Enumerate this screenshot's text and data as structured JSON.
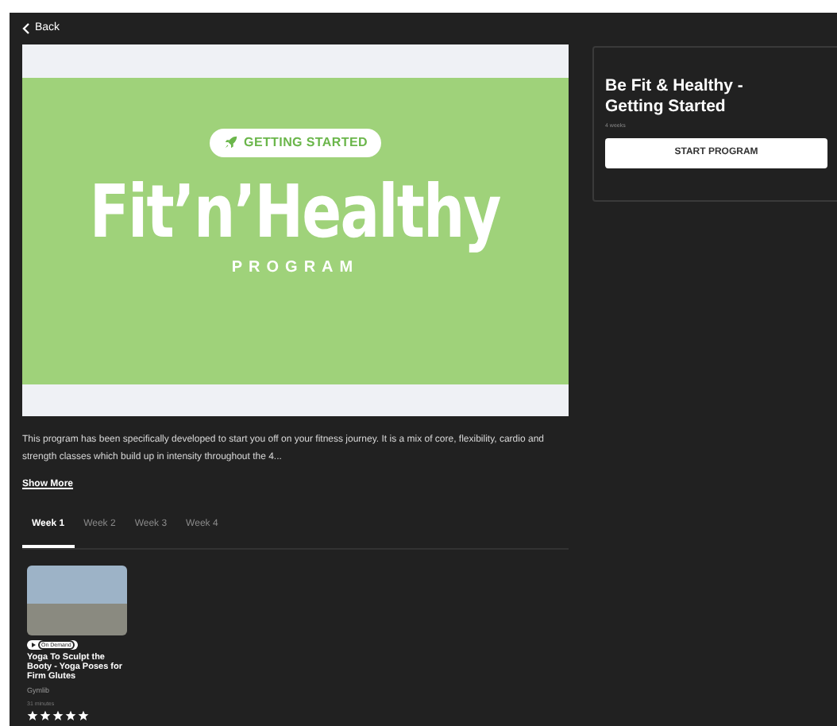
{
  "back": {
    "label": "Back"
  },
  "hero": {
    "badge": "GETTING STARTED",
    "title": "Fit’n’Healthy",
    "subtitle": "PROGRAM"
  },
  "program_card": {
    "title": "Be Fit & Healthy - Getting Started",
    "duration": "4 weeks",
    "button": "START PROGRAM"
  },
  "description": "This program has been specifically developed to start you off on your fitness journey. It is a mix of core, flexibility, cardio and strength classes which build up in intensity throughout the 4...",
  "show_more": "Show More",
  "tabs": [
    {
      "label": "Week 1",
      "selected": true
    },
    {
      "label": "Week 2",
      "selected": false
    },
    {
      "label": "Week 3",
      "selected": false
    },
    {
      "label": "Week 4",
      "selected": false
    }
  ],
  "classes": [
    {
      "badge": "On Demand",
      "title": "Yoga To Sculpt the Booty - Yoga Poses for Firm Glutes",
      "provider": "Gymlib",
      "duration": "31 minutes",
      "stars": 5
    }
  ]
}
